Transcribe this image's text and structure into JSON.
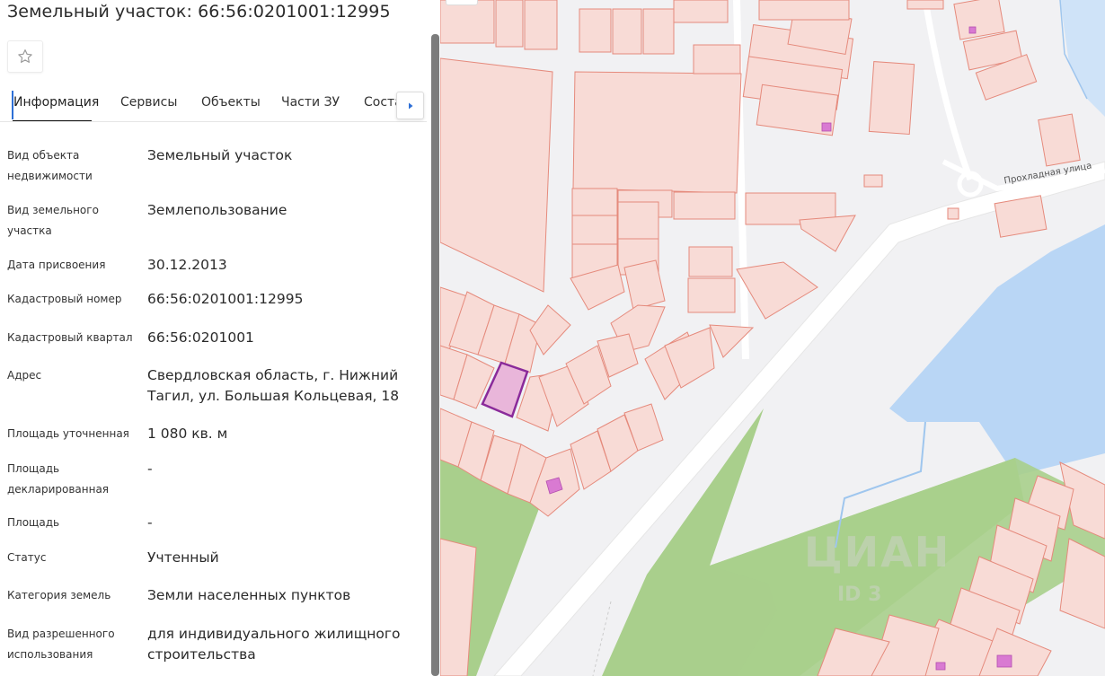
{
  "title": "Земельный участок: 66:56:0201001:12995",
  "tabs": [
    {
      "label": "Информация"
    },
    {
      "label": "Сервисы"
    },
    {
      "label": "Объекты"
    },
    {
      "label": "Части ЗУ"
    },
    {
      "label": "Соста"
    }
  ],
  "rows": [
    {
      "label": "Вид объекта\nнедвижимости",
      "value": "Земельный участок"
    },
    {
      "label": "Вид земельного\nучастка",
      "value": "Землепользование"
    },
    {
      "label": "Дата присвоения",
      "value": "30.12.2013"
    },
    {
      "label": "Кадастровый номер",
      "value": "66:56:0201001:12995"
    },
    {
      "label": "Кадастровый квартал",
      "value": "66:56:0201001"
    },
    {
      "label": "Адрес",
      "value": "Свердловская область, г. Нижний\nТагил, ул. Большая Кольцевая, 18"
    },
    {
      "label": "Площадь уточненная",
      "value": "1 080 кв. м"
    },
    {
      "label": "Площадь\nдекларированная",
      "value": "-"
    },
    {
      "label": "Площадь",
      "value": "-"
    },
    {
      "label": "Статус",
      "value": "Учтенный"
    },
    {
      "label": "Категория земель",
      "value": "Земли населенных пунктов"
    },
    {
      "label": "Вид разрешенного\nиспользования",
      "value": "для индивидуального жилищного\nстроительства"
    }
  ],
  "map": {
    "street_label": "Прохладная улица",
    "watermark": "ЦИАН",
    "watermark_id": "ID 3",
    "colors": {
      "parcel_fill": "#f8dbd6",
      "parcel_stroke": "#e58a7c",
      "selected_fill": "#e9b6da",
      "selected_stroke": "#8a2a9a",
      "water": "#b9d6f5",
      "green": "#a9cf8c",
      "road": "#ffffff",
      "building": "#d97ad2"
    }
  },
  "icons": {
    "favorite": "star-outline-icon",
    "tabs_next": "caret-right-icon"
  }
}
